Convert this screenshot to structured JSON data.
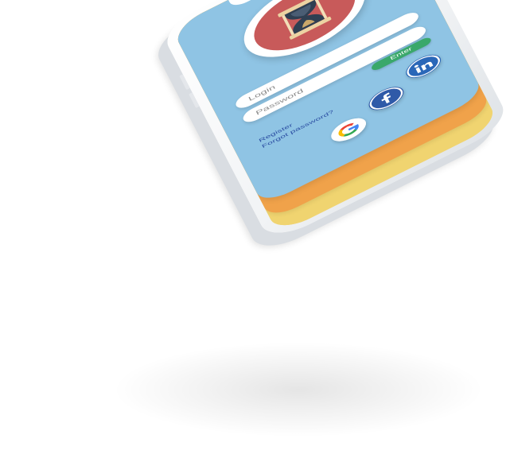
{
  "login": {
    "login_placeholder": "Login",
    "password_placeholder": "Password",
    "enter_label": "Enter",
    "register_link": "Register",
    "forgot_link": "Forgot password?"
  },
  "social": [
    {
      "icon": "linkedin-icon",
      "glyph": "in",
      "color": "#2a67b8"
    },
    {
      "icon": "facebook-icon",
      "glyph": "f",
      "color": "#2f5aa8"
    },
    {
      "icon": "google-icon",
      "glyph": "G",
      "color": "#ffffff"
    }
  ],
  "logo": {
    "icon": "hourglass-icon"
  },
  "colors": {
    "screen_blue": "#8fc4e4",
    "card_orange": "#f0a24a",
    "card_yellow": "#f0d470",
    "logo_red": "#c85a5a",
    "enter_green": "#3aa86b",
    "link_blue": "#2c4fa3"
  }
}
